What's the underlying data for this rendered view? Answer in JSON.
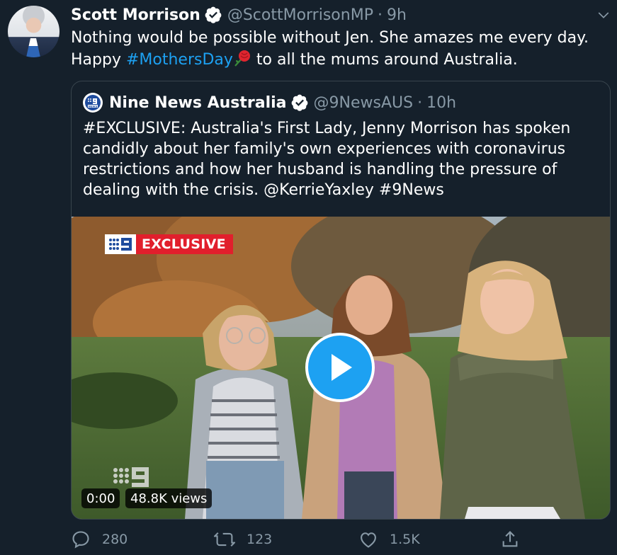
{
  "tweet": {
    "author_name": "Scott Morrison",
    "author_handle": "@ScottMorrisonMP",
    "separator": "·",
    "time": "9h",
    "text_line1": "Nothing would be possible without Jen. She amazes me every day.",
    "text_happy": "Happy",
    "hashtag": "#MothersDay",
    "text_rest": "to all the mums around Australia."
  },
  "quote": {
    "author_name": "Nine News Australia",
    "author_handle": "@9NewsAUS",
    "separator": "·",
    "time": "10h",
    "text": "#EXCLUSIVE: Australia's First Lady, Jenny Morrison has spoken candidly about her family's own experiences with coronavirus restrictions and how her husband is handling the pressure of dealing with the crisis. @KerrieYaxley #9News",
    "video": {
      "badge_text": "EXCLUSIVE",
      "timestamp": "0:00",
      "views": "48.8K views"
    }
  },
  "actions": {
    "reply_count": "280",
    "retweet_count": "123",
    "like_count": "1.5K"
  },
  "colors": {
    "background": "#15202b",
    "accent": "#1da1f2",
    "muted": "#8899a6",
    "border": "#38444d",
    "exclusive_red": "#e11f2c"
  },
  "icons": [
    "verified-icon",
    "chevron-down-icon",
    "rose-emoji-icon",
    "nine-logo-icon",
    "play-icon",
    "reply-icon",
    "retweet-icon",
    "like-icon",
    "share-icon"
  ]
}
